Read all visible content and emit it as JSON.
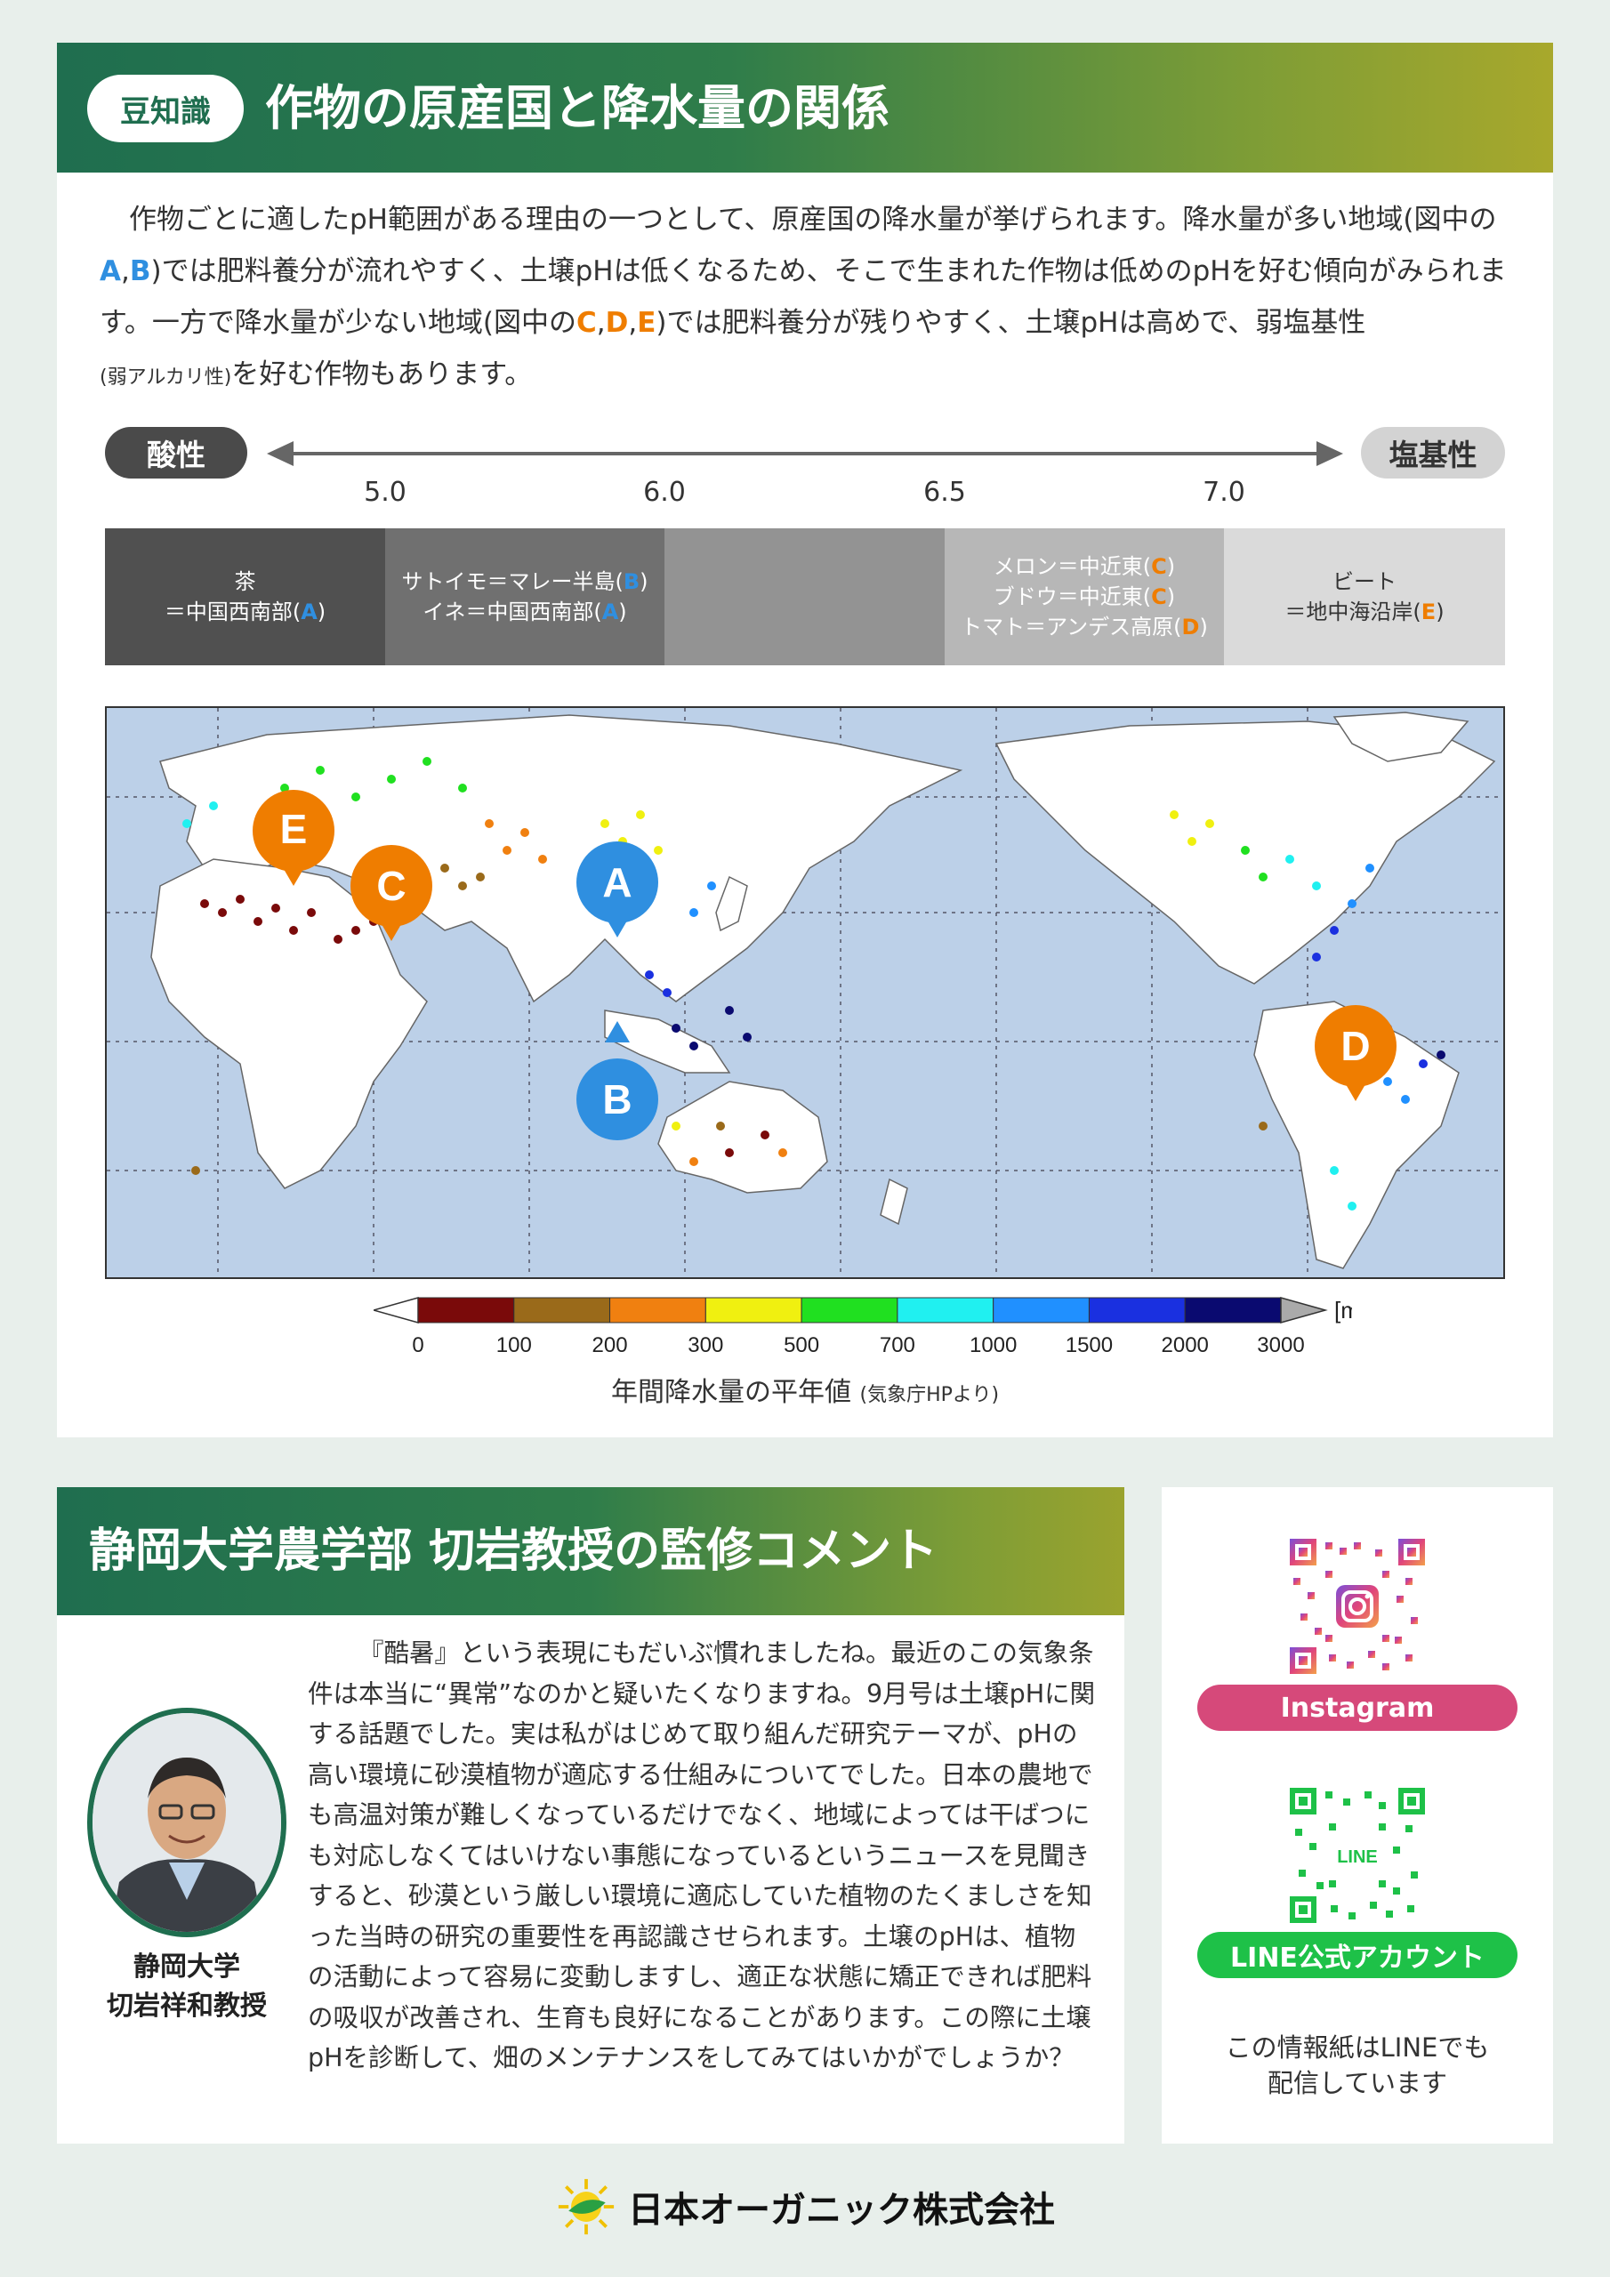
{
  "top": {
    "badge": "豆知識",
    "title": "作物の原産国と降水量の関係",
    "intro": {
      "p1_a": "作物ごとに適したpH範囲がある理由の一つとして、原産国の降水量が挙げられます。降水量が多い地域(図中の",
      "A": "A",
      "comma1": ",",
      "B": "B",
      "p1_b": ")では肥料養分が流れやすく、土壌pHは低くなるため、そこで生まれた作物は低めのpHを好む傾向がみられます。一方で降水量が少ない地域(図中の",
      "C": "C",
      "comma2": ",",
      "D": "D",
      "comma3": ",",
      "E": "E",
      "p1_c": ")では肥料養分が残りやすく、土壌pHは高めで、弱塩基性",
      "small": "(弱アルカリ性)",
      "p1_d": "を好む作物もあります。"
    }
  },
  "ph_scale": {
    "acid_label": "酸性",
    "base_label": "塩基性",
    "ticks": [
      "5.0",
      "6.0",
      "6.5",
      "7.0"
    ],
    "segments": [
      {
        "lines": [
          [
            "茶",
            ""
          ],
          [
            "＝中国西南部(",
            "A",
            ")"
          ]
        ]
      },
      {
        "lines": [
          [
            "サトイモ＝マレー半島(",
            "B",
            ")"
          ],
          [
            "イネ＝中国西南部(",
            "A",
            ")"
          ]
        ]
      },
      {
        "lines": []
      },
      {
        "lines": [
          [
            "メロン＝中近東(",
            "C",
            ")"
          ],
          [
            "ブドウ＝中近東(",
            "C",
            ")"
          ],
          [
            "トマト＝アンデス高原(",
            "D",
            ")"
          ]
        ]
      },
      {
        "lines": [
          [
            "ビート",
            ""
          ],
          [
            "＝地中海沿岸(",
            "E",
            ")"
          ]
        ]
      }
    ],
    "seg_colors": [
      "#505050",
      "#707070",
      "#939393",
      "#b7b7b7",
      "#dadada"
    ],
    "accent_ab": "#2f8fe0",
    "accent_cde": "#ef7d00"
  },
  "map": {
    "pins": [
      {
        "label": "E",
        "color": "#ef7d00"
      },
      {
        "label": "C",
        "color": "#ef7d00"
      },
      {
        "label": "A",
        "color": "#2f8fe0"
      },
      {
        "label": "B",
        "color": "#2f8fe0"
      },
      {
        "label": "D",
        "color": "#ef7d00"
      }
    ]
  },
  "legend": {
    "values": [
      "0",
      "100",
      "200",
      "300",
      "500",
      "700",
      "1000",
      "1500",
      "2000",
      "3000"
    ],
    "unit": "[mm]",
    "colors": [
      "#7a0a0a",
      "#9a6a1a",
      "#f08010",
      "#f0f010",
      "#20e020",
      "#20f0f0",
      "#2090ff",
      "#1a30e0",
      "#0a0a70"
    ],
    "caption": "年間降水量の平年値",
    "source": "(気象庁HPより)"
  },
  "bottom": {
    "title": "静岡大学農学部 切岩教授の監修コメント",
    "prof_name_1": "静岡大学",
    "prof_name_2": "切岩祥和教授",
    "comment": "『酷暑』という表現にもだいぶ慣れましたね。最近のこの気象条件は本当に“異常”なのかと疑いたくなりますね。9月号は土壌pHに関する話題でした。実は私がはじめて取り組んだ研究テーマが、pHの高い環境に砂漠植物が適応する仕組みについてでした。日本の農地でも高温対策が難しくなっているだけでなく、地域によっては干ばつにも対応しなくてはいけない事態になっているというニュースを見聞きすると、砂漠という厳しい環境に適応していた植物のたくましさを知った当時の研究の重要性を再認識させられます。土壌のpHは、植物の活動によって容易に変動しますし、適正な状態に矯正できれば肥料の吸収が改善され、生育も良好になることがあります。この際に土壌pHを診断して、畑のメンテナンスをしてみてはいかがでしょうか？"
  },
  "side": {
    "instagram_label": "Instagram",
    "instagram_color": "#d6497a",
    "line_qr_text": "LINE",
    "line_label": "LINE公式アカウント",
    "line_color": "#1ec148",
    "note_1": "この情報紙はLINEでも",
    "note_2": "配信しています"
  },
  "footer": {
    "company": "日本オーガニック株式会社"
  }
}
